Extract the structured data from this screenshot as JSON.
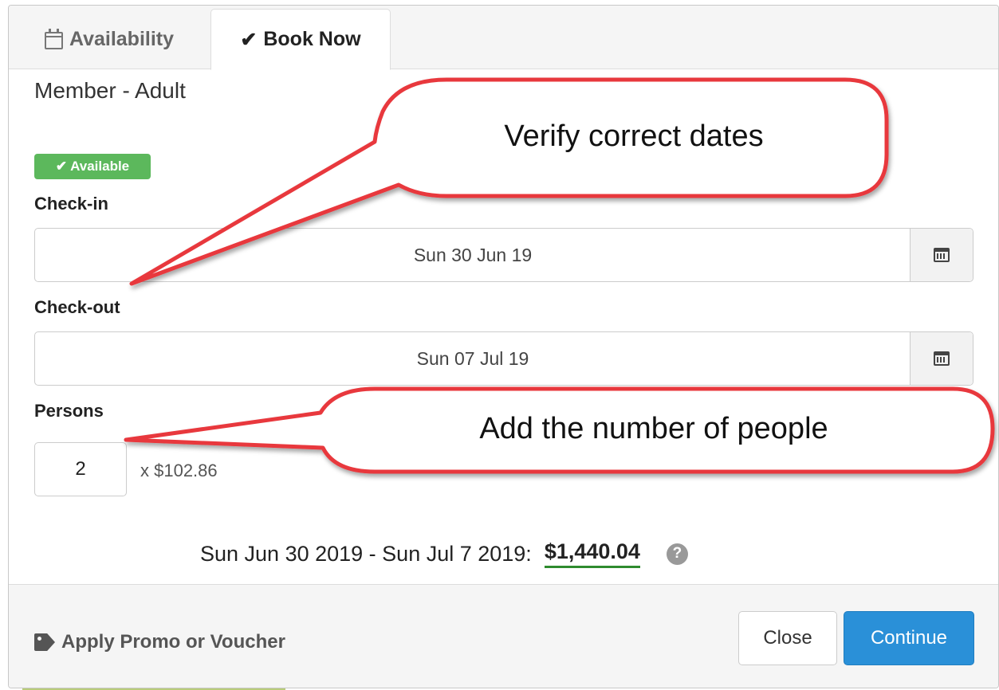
{
  "tabs": [
    {
      "label": "Availability",
      "icon": "calendar-outline-icon",
      "active": false
    },
    {
      "label": "Book Now",
      "icon": "checkmark-icon",
      "active": true
    }
  ],
  "product": "Member - Adult",
  "status_badge": {
    "label": "Available",
    "icon": "checkmark-icon",
    "color": "#5cb85c"
  },
  "checkin": {
    "label": "Check-in",
    "value": "Sun 30 Jun 19",
    "icon": "calendar-icon"
  },
  "checkout": {
    "label": "Check-out",
    "value": "Sun 07 Jul 19",
    "icon": "calendar-icon"
  },
  "persons": {
    "label": "Persons",
    "value": "2",
    "price_each": "x $102.86"
  },
  "summary": {
    "range": "Sun Jun 30 2019 - Sun Jul 7 2019:",
    "total": "$1,440.04",
    "help_icon": "question-circle-icon"
  },
  "footer": {
    "promo_label": "Apply Promo or Voucher",
    "promo_icon": "tag-icon",
    "close_label": "Close",
    "continue_label": "Continue",
    "continue_color": "#2a90d8"
  },
  "annotations": {
    "dates_note": "Verify correct dates",
    "people_note": "Add the number of people",
    "callout_border_color": "#e8383d"
  }
}
